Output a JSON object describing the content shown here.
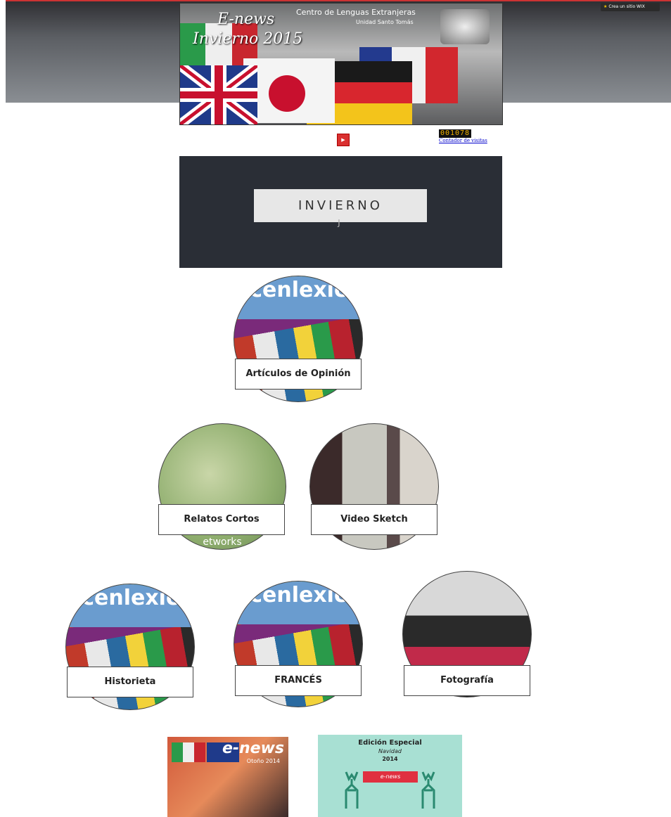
{
  "wix_badge": {
    "label": "Crea un sitio WIX"
  },
  "banner": {
    "title_line1": "E-news",
    "title_line2": "Invierno 2015",
    "center_name": "Centro de Lenguas Extranjeras",
    "unit": "Unidad Santo Tomás"
  },
  "visit_counter": {
    "value": "001078",
    "link": "Contador de visitas"
  },
  "season_section": {
    "button_label": "INVIERNO",
    "scroll_glyph": "ȷ"
  },
  "sections": [
    {
      "label": "Artículos de Opinión",
      "image_text": "cenlexic"
    },
    {
      "label": "Relatos Cortos",
      "image_text": "etworks"
    },
    {
      "label": "Video Sketch"
    },
    {
      "label": "Historieta",
      "image_text": "cenlexic"
    },
    {
      "label": "FRANCÉS",
      "image_text": "cenlexic"
    },
    {
      "label": "Fotografía"
    }
  ],
  "editions": [
    {
      "title": "e-news",
      "subtitle": "Otoño 2014"
    },
    {
      "title": "Edición Especial",
      "subtitle": "Navidad",
      "year": "2014",
      "ribbon": "e-news"
    }
  ],
  "colors": {
    "dark_section": "#2a2e36",
    "accent_red": "#d93030"
  }
}
